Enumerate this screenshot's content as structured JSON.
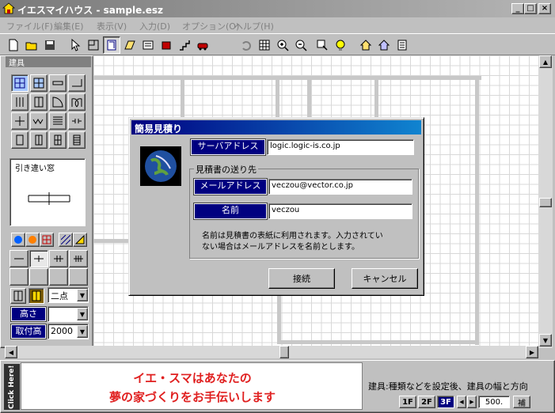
{
  "window": {
    "title": "イエスマイハウス - sample.esz",
    "min": "_",
    "max": "□",
    "close": "×"
  },
  "menu": [
    "ファイル(F)",
    "編集(E)",
    "表示(V)",
    "入力(D)",
    "オプション(O)",
    "ヘルプ(H)"
  ],
  "palette": {
    "title": "建具",
    "preview_label": "引き違い窓",
    "height_label": "高さ",
    "height_value": "",
    "mount_label": "取付高",
    "mount_value": "2000",
    "point_select": "二点"
  },
  "dialog": {
    "title": "簡易見積り",
    "server_label": "サーバアドレス",
    "server_value": "logic.logic-is.co.jp",
    "group_label": "見積書の送り先",
    "email_label": "メールアドレス",
    "email_value": "veczou@vector.co.jp",
    "name_label": "名前",
    "name_value": "veczou",
    "note_line1": "名前は見積書の表紙に利用されます。入力されてい",
    "note_line2": "ない場合はメールアドレスを名前とします。",
    "connect_button": "接続",
    "cancel_button": "キャンセル"
  },
  "status": {
    "click_here": "Click Here!",
    "banner_line1": "イエ・スマはあなたの",
    "banner_line2": "夢の家づくりをお手伝いします",
    "hint": "建具:種類などを設定後、建具の幅と方向",
    "floor1": "1F",
    "floor2": "2F",
    "floor3": "3F",
    "zoom": "500.",
    "snap": "補"
  },
  "colors": {
    "dialog_title": "#000080",
    "banner_text": "#e02020",
    "label_bg": "#000080"
  }
}
